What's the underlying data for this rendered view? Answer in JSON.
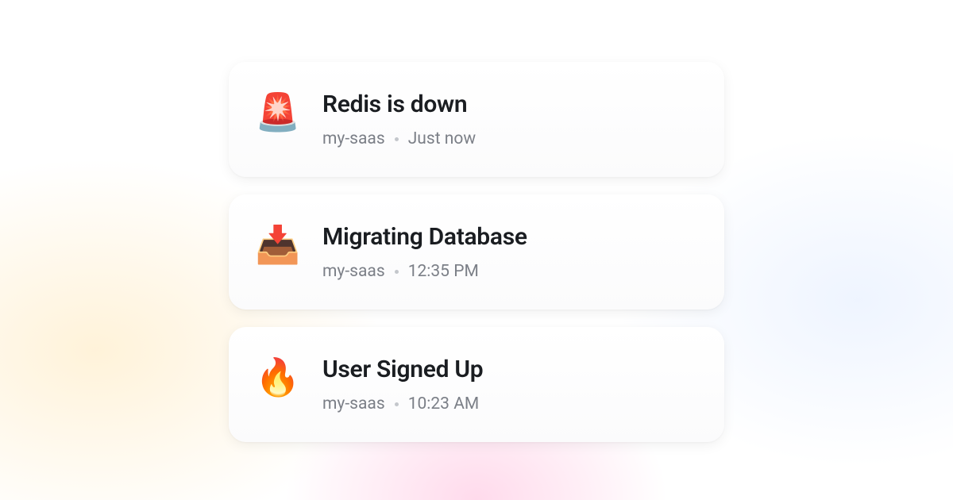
{
  "notifications": [
    {
      "icon": "🚨",
      "icon_name": "siren-icon",
      "title": "Redis is down",
      "source": "my-saas",
      "time": "Just now"
    },
    {
      "icon": "📥",
      "icon_name": "inbox-arrow-icon",
      "title": "Migrating Database",
      "source": "my-saas",
      "time": "12:35 PM"
    },
    {
      "icon": "🔥",
      "icon_name": "fire-icon",
      "title": "User Signed Up",
      "source": "my-saas",
      "time": "10:23 AM"
    }
  ]
}
